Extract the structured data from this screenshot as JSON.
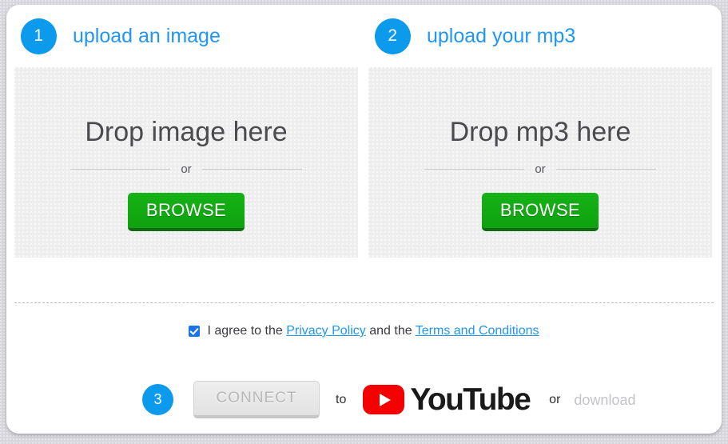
{
  "theme": {
    "accent_blue": "#0c9aec",
    "link_blue": "#2196f3",
    "browse_green": "#12a912",
    "youtube_red": "#f40000",
    "card_bg": "#ffffff",
    "dropzone_bg": "#eeeeee",
    "page_bg": "#d6d6dc",
    "disabled_gray": "#c3c3c8"
  },
  "steps": [
    {
      "number": "1",
      "title": "upload an image",
      "dropzone": {
        "title": "Drop image here",
        "or_label": "or",
        "browse_label": "BROWSE"
      }
    },
    {
      "number": "2",
      "title": "upload your mp3",
      "dropzone": {
        "title": "Drop mp3 here",
        "or_label": "or",
        "browse_label": "BROWSE"
      }
    }
  ],
  "agreement": {
    "checked": true,
    "prefix": "I agree to the ",
    "privacy_link": "Privacy Policy",
    "middle": " and the ",
    "terms_link": "Terms and Conditions"
  },
  "connect": {
    "step_number": "3",
    "button_label": "CONNECT",
    "button_disabled": true,
    "to_label": "to",
    "youtube_wordmark": "YouTube",
    "or_label": "or",
    "download_label": "download",
    "download_disabled": true
  }
}
